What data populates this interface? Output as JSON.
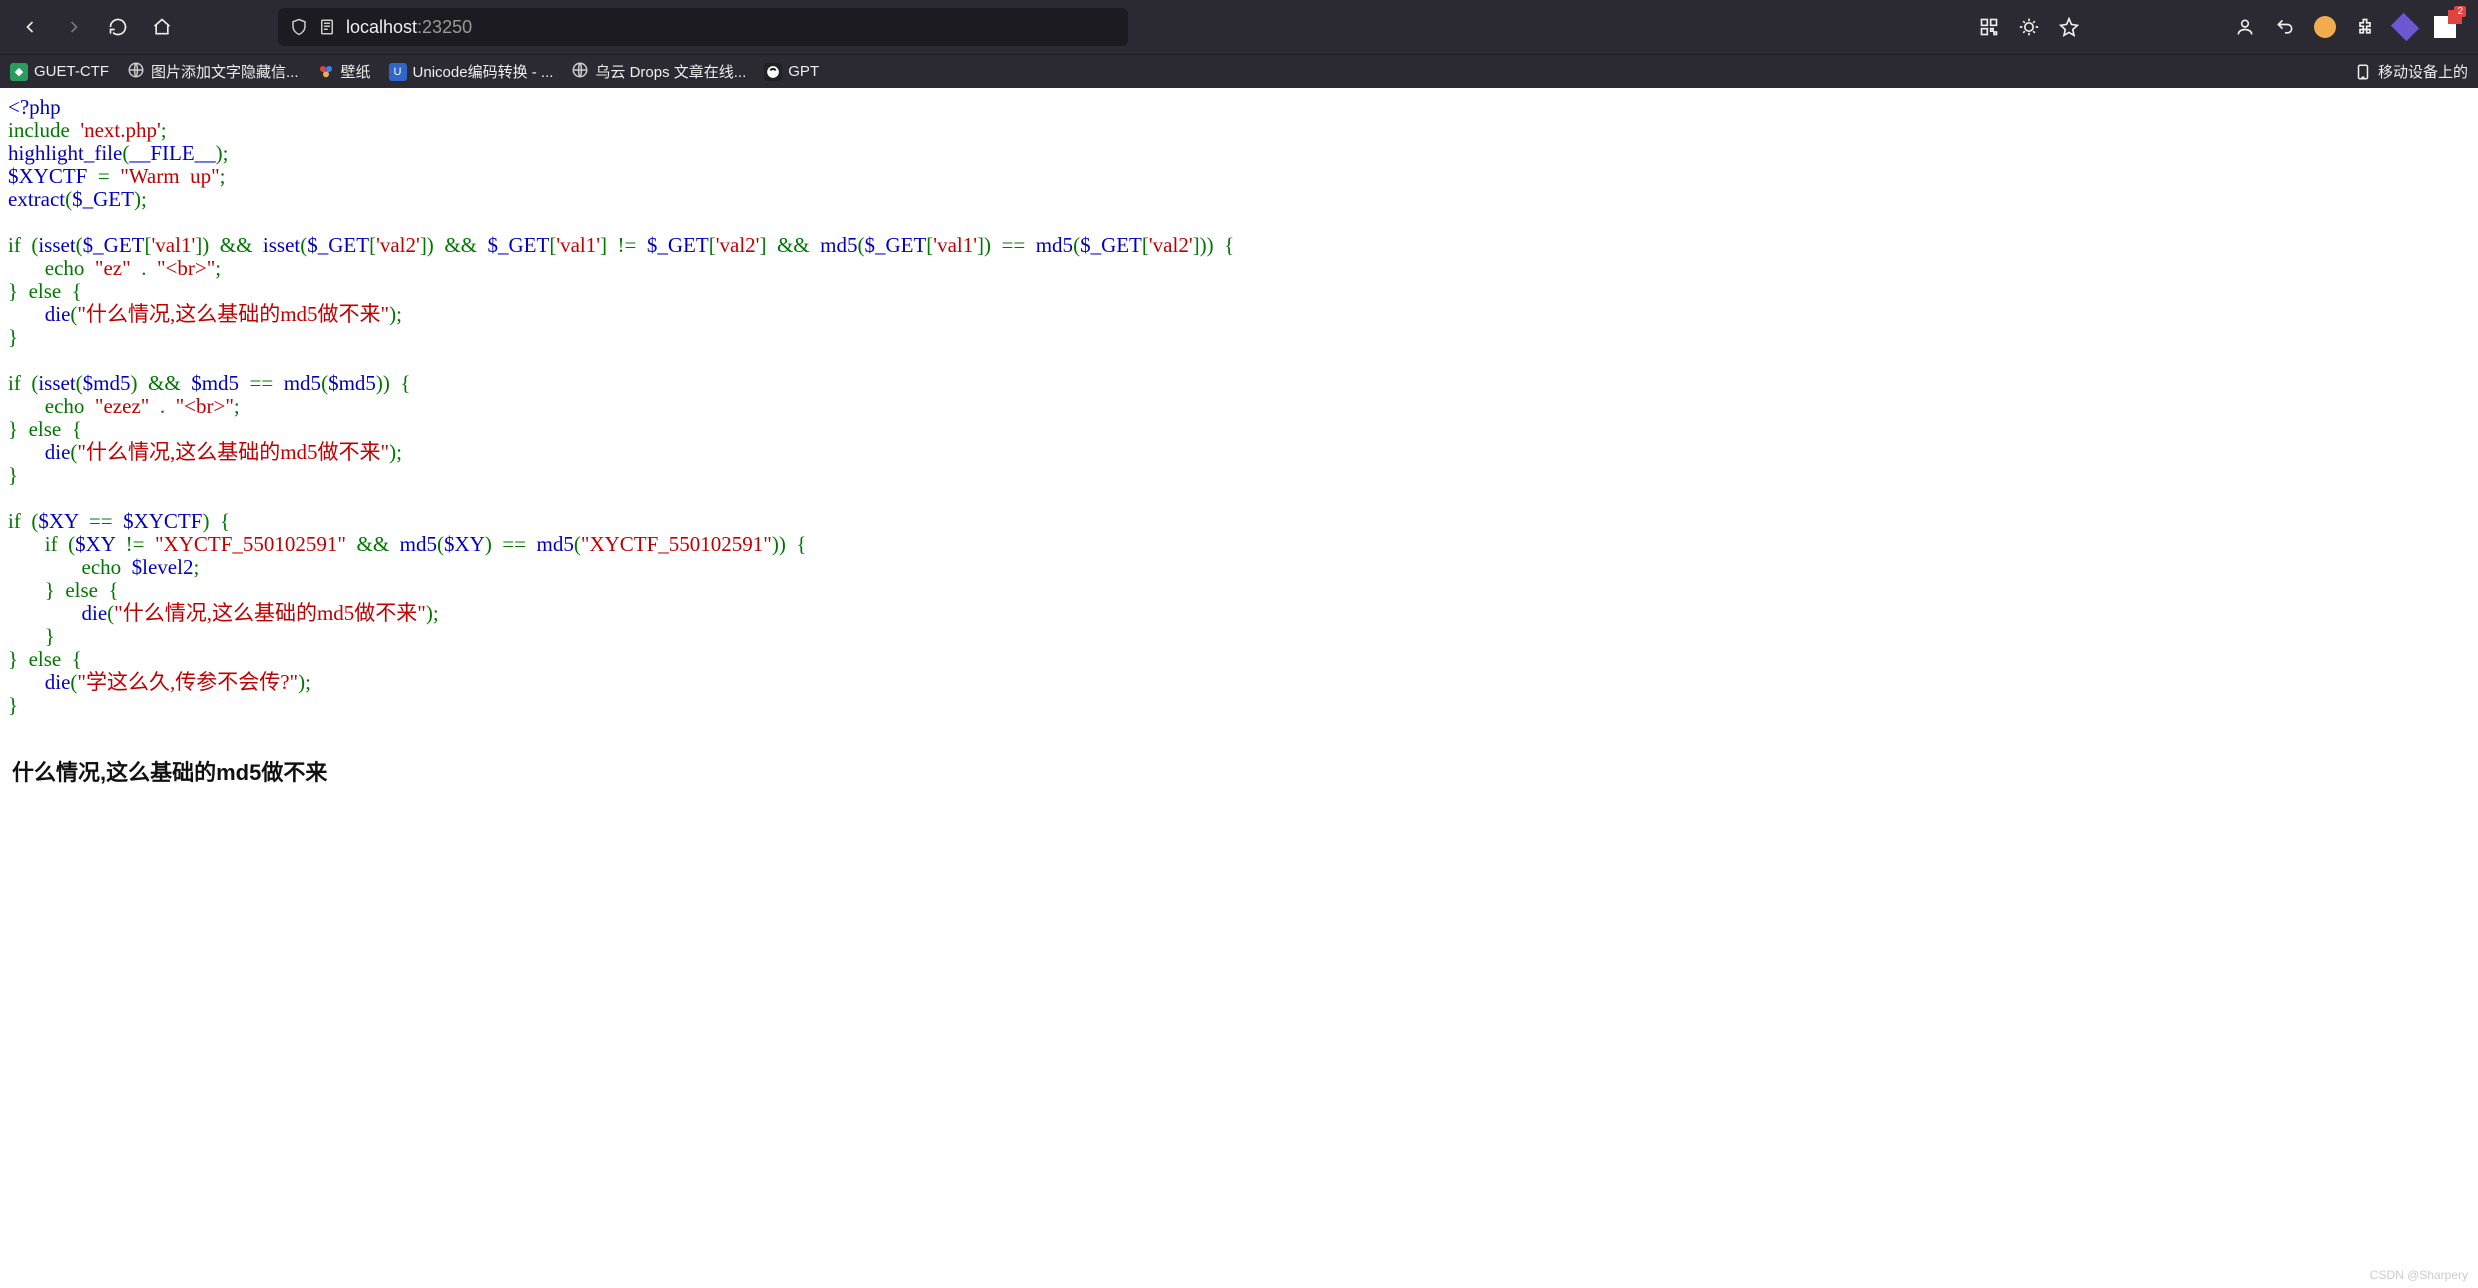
{
  "url": {
    "host": "localhost",
    "port": ":23250"
  },
  "bookmarks": {
    "b1": "GUET-CTF",
    "b2": "图片添加文字隐藏信...",
    "b3": "壁纸",
    "b4": "Unicode编码转换 - ...",
    "b5": "乌云 Drops 文章在线...",
    "b6": "GPT",
    "right": "移动设备上的"
  },
  "badge": "2",
  "code": {
    "open_tag": "<?php",
    "include_kw": "include ",
    "include_file": "'next.php'",
    "hl_fn": "highlight_file",
    "hl_arg": "__FILE__",
    "xyctf_var": "$XYCTF",
    "xyctf_val": "\"Warm  up\"",
    "extract_fn": "extract",
    "extract_arg": "$_GET",
    "if1_isset1": "isset",
    "if1_get1": "$_GET",
    "if1_idx1": "'val1'",
    "if1_isset2": "isset",
    "if1_get2": "$_GET",
    "if1_idx2": "'val2'",
    "if1_get3": "$_GET",
    "if1_idx3": "'val1'",
    "if1_get4": "$_GET",
    "if1_idx4": "'val2'",
    "if1_md51": "md5",
    "if1_md5g1": "$_GET",
    "if1_md5i1": "'val1'",
    "if1_md52": "md5",
    "if1_md5g2": "$_GET",
    "if1_md5i2": "'val2'",
    "echo1_kw": "echo ",
    "echo1_s1": "\"ez\"",
    "echo1_s2": "\"<br>\"",
    "die1_fn": "die",
    "die1_str": "\"什么情况,这么基础的md5做不来\"",
    "if2_isset": "isset",
    "if2_var1": "$md5",
    "if2_var2": "$md5",
    "if2_md5": "md5",
    "if2_var3": "$md5",
    "echo2_kw": "echo ",
    "echo2_s1": "\"ezez\"",
    "echo2_s2": "\"<br>\"",
    "die2_fn": "die",
    "die2_str": "\"什么情况,这么基础的md5做不来\"",
    "if3_v1": "$XY",
    "if3_v2": "$XYCTF",
    "if3_v3": "$XY",
    "if3_s1": "\"XYCTF_550102591\"",
    "if3_md51": "md5",
    "if3_v4": "$XY",
    "if3_md52": "md5",
    "if3_s2": "\"XYCTF_550102591\"",
    "echo3_kw": "echo ",
    "echo3_var": "$level2",
    "die3_fn": "die",
    "die3_str": "\"什么情况,这么基础的md5做不来\"",
    "die4_fn": "die",
    "die4_str": "\"学这么久,传参不会传?\""
  },
  "output_text": "什么情况,这么基础的md5做不来",
  "watermark": "CSDN @Sharpery"
}
